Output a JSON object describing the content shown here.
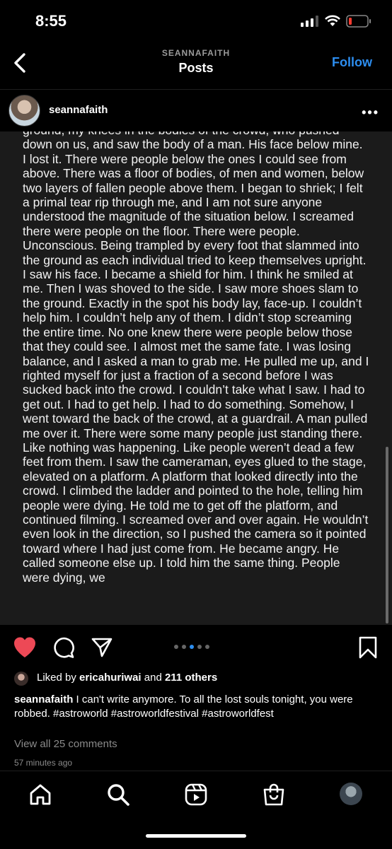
{
  "status_bar": {
    "time": "8:55"
  },
  "header": {
    "username": "SEANNAFAITH",
    "title": "Posts",
    "follow_label": "Follow"
  },
  "post": {
    "username": "seannafaith",
    "body_text": "ground, my knees in the bodies of the crowd, who pushed down on us, and saw the body of a man. His face below mine. I lost it. There were people below the ones I could see from above. There was a floor of bodies, of men and women, below two layers of fallen people above them. I began to shriek; I felt a primal tear rip through me, and I am not sure anyone understood the magnitude of the situation below. I screamed there were people on the floor. There were people. Unconscious. Being trampled by every foot that slammed into the ground as each individual tried to keep themselves upright. I saw his face. I became a shield for him. I think he smiled at me. Then I was shoved to the side. I saw more shoes slam to the ground. Exactly in the spot his body lay, face-up. I couldn’t help him. I couldn’t help any of them. I didn’t stop screaming the entire time. No one knew there were people below those that they could see. I almost met the same fate. I was losing balance, and I asked a man to grab me. He pulled me up, and I righted myself for just a fraction of a second before I was sucked back into the crowd. I couldn’t take what I saw. I had to get out. I had to get help. I had to do something. Somehow, I went toward the back of the crowd, at a guardrail. A man pulled me over it. There were some many people just standing there. Like nothing was happening. Like people weren’t dead a few feet from them. I saw the cameraman, eyes glued to the stage, elevated on a platform. A platform that looked directly into the crowd. I climbed the ladder and pointed to the hole, telling him people were dying. He told me to get off the platform, and continued filming. I screamed over and over again. He wouldn’t even look in the direction, so I pushed the camera so it pointed toward where I had just come from. He became angry. He called someone else up. I told him the same thing. People were dying, we",
    "carousel": {
      "count": 5,
      "active_index": 3
    },
    "likes": {
      "prefix": "Liked by",
      "user": "ericahuriwai",
      "conj": "and",
      "others": "211 others"
    },
    "caption": {
      "user": "seannafaith",
      "text": "I can't write anymore. To all the lost souls tonight, you were robbed. #astroworld #astroworldfestival #astroworldfest"
    },
    "comments_label": "View all 25 comments",
    "time_ago": "57 minutes ago"
  },
  "colors": {
    "accent": "#2d8ef0",
    "like": "#ed4956",
    "background": "#000000"
  },
  "icons": [
    "back-chevron-icon",
    "more-icon",
    "heart-icon",
    "comment-icon",
    "share-icon",
    "bookmark-icon",
    "home-icon",
    "search-icon",
    "reels-icon",
    "shop-icon",
    "profile-avatar"
  ]
}
